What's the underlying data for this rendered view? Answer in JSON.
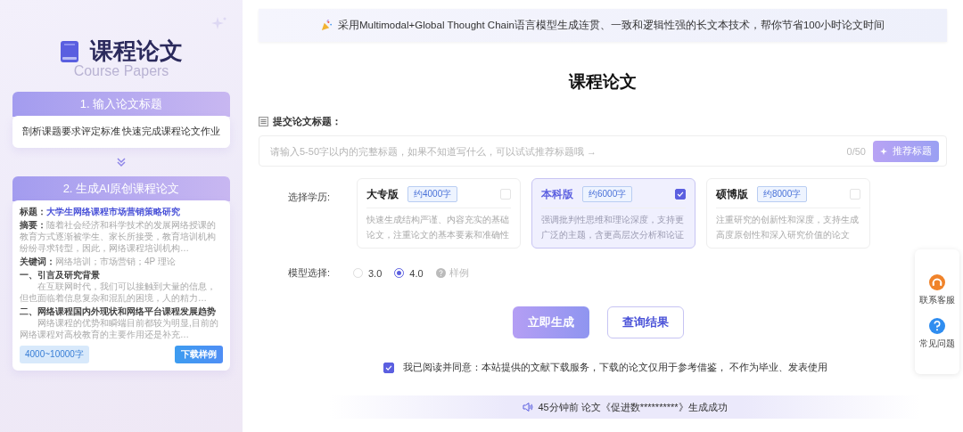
{
  "sidebar": {
    "title": "课程论文",
    "ghost_subtitle": "Course Papers",
    "steps": [
      {
        "kind": "summary",
        "title": "1. 输入论文标题",
        "description": "剖析课题要求评定标准 快速完成课程论文作业"
      },
      {
        "kind": "sample",
        "title": "2. 生成AI原创课程论文",
        "sample": {
          "title_label": "标题：",
          "title_value": "大学生网络课程市场营销策略研究",
          "abstract_label": "摘要：",
          "abstract": "随着社会经济和科学技术的发展网络授课的教育方式逐渐被学生、家长所接受，教育培训机构纷纷寻求转型，因此，网络课程培训机构…",
          "keywords_label": "关键词：",
          "keywords": "网络培训；市场营销；4P 理论",
          "sections": [
            {
              "heading": "一、引言及研究背景",
              "text": "在互联网时代，我们可以接触到大量的信息，但也面临着信息复杂和混乱的困境，人的精力…"
            },
            {
              "heading": "二、网络课程国内外现状和网络平台课程发展趋势",
              "text": "网络课程的优势和瞬端目前都较为明显,目前的网络课程对高校教育的主要作用还是补充…"
            }
          ],
          "word_range": "4000~10000字",
          "download_button": "下载样例"
        }
      }
    ]
  },
  "banner": {
    "text": "采用Multimodal+Global Thought Chain语言模型生成连贯、一致和逻辑性强的长文本技术，帮你节省100小时论文时间"
  },
  "heading": "课程论文",
  "title_field": {
    "label": "提交论文标题：",
    "placeholder": "请输入5-50字以内的完整标题，如果不知道写什么，可以试试推荐标题哦 →",
    "counter": "0/50",
    "suggest_button": "推荐标题"
  },
  "education": {
    "label": "选择学历:",
    "options": [
      {
        "name": "大专版",
        "words": "约4000字",
        "description": "快速生成结构严谨、内容充实的基础论文，注重论文的基本要素和准确性",
        "selected": false
      },
      {
        "name": "本科版",
        "words": "约6000字",
        "description": "强调批判性思维和理论深度，支持更广泛的主题，含更高层次分析和论证",
        "selected": true
      },
      {
        "name": "硕博版",
        "words": "约8000字",
        "description": "注重研究的创新性和深度，支持生成高度原创性和深入研究价值的论文",
        "selected": false
      }
    ]
  },
  "model": {
    "label": "模型选择:",
    "options": [
      {
        "label": "3.0",
        "selected": false
      },
      {
        "label": "4.0",
        "selected": true
      }
    ],
    "sample_link": "样例"
  },
  "buttons": [
    {
      "kind": "primary",
      "label": "立即生成"
    },
    {
      "kind": "secondary",
      "label": "查询结果"
    }
  ],
  "agreement": {
    "checked": true,
    "text": "我已阅读并同意：本站提供的文献下载服务，下载的论文仅用于参考借鉴， 不作为毕业、发表使用"
  },
  "ticker": {
    "text": "45分钟前 论文《促进数**********》生成成功"
  },
  "help_panel": [
    {
      "kind": "support",
      "label": "联系客服"
    },
    {
      "kind": "faq",
      "label": "常见问题"
    }
  ]
}
